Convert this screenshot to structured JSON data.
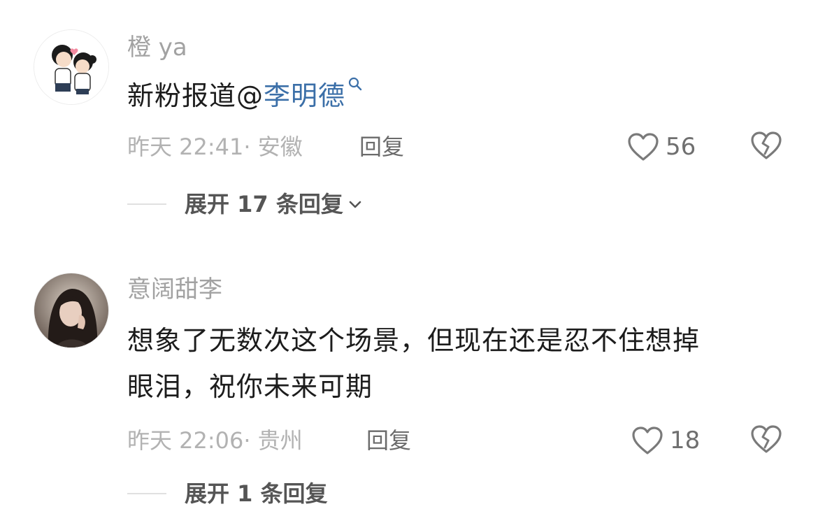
{
  "comments": [
    {
      "username": "橙 ya",
      "content_prefix": "新粉报道@",
      "mention": "李明德",
      "time_location": "昨天 22:41· 安徽",
      "reply_label": "回复",
      "likes": "56",
      "expand_label": "展开 17 条回复"
    },
    {
      "username": "意阔甜李",
      "content_line1": "想象了无数次这个场景，但现在还是忍不住想掉",
      "content_line2": "眼泪，祝你未来可期",
      "time_location": "昨天 22:06· 贵州",
      "reply_label": "回复",
      "likes": "18",
      "expand_label": "展开 1 条回复"
    }
  ],
  "icons": {
    "like": "heart-outline-icon",
    "dislike": "broken-heart-icon",
    "mention_search": "search-icon",
    "expand": "chevron-down-icon"
  },
  "colors": {
    "mention": "#3b6fa8",
    "meta_text": "#b2b2b2",
    "username": "#a2a2a2"
  }
}
